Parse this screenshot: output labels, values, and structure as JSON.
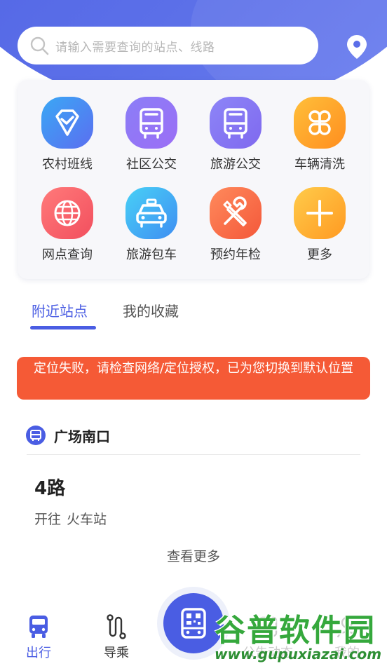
{
  "search": {
    "placeholder": "请输入需要查询的站点、线路"
  },
  "grid": [
    {
      "label": "农村班线",
      "icon": "diamond-check-icon",
      "colors": [
        "#3aa8f5",
        "#5b6ef0"
      ]
    },
    {
      "label": "社区公交",
      "icon": "bus-icon",
      "colors": [
        "#8b7ef7",
        "#9b6ef5"
      ]
    },
    {
      "label": "旅游公交",
      "icon": "bus-icon",
      "colors": [
        "#8d85f7",
        "#7f69ef"
      ]
    },
    {
      "label": "车辆清洗",
      "icon": "clover-icon",
      "colors": [
        "#ffbf3a",
        "#ff8e1f"
      ]
    },
    {
      "label": "网点查询",
      "icon": "globe-icon",
      "colors": [
        "#ff7a7a",
        "#f24f5e"
      ]
    },
    {
      "label": "旅游包车",
      "icon": "taxi-icon",
      "colors": [
        "#48d0f6",
        "#3f8ef2"
      ]
    },
    {
      "label": "预约年检",
      "icon": "tools-icon",
      "colors": [
        "#ff8a5c",
        "#f4583a"
      ]
    },
    {
      "label": "更多",
      "icon": "plus-icon",
      "colors": [
        "#ffcb4a",
        "#ff9a22"
      ]
    }
  ],
  "tabs": {
    "nearby": "附近站点",
    "favorites": "我的收藏"
  },
  "error": "定位失败，请检查网络/定位授权，已为您切换到默认位置",
  "station": {
    "name": "广场南口",
    "route": "4路",
    "direction": "开往",
    "destination": "火车站"
  },
  "more": "查看更多",
  "nav": {
    "go": "出行",
    "guide": "导乘",
    "info": "公告动态",
    "mine": "我的"
  },
  "watermark": {
    "title": "谷普软件园",
    "url": "www.gupuxiazai.com"
  },
  "colors": {
    "accent": "#4a5de3",
    "error": "#f55a36"
  }
}
